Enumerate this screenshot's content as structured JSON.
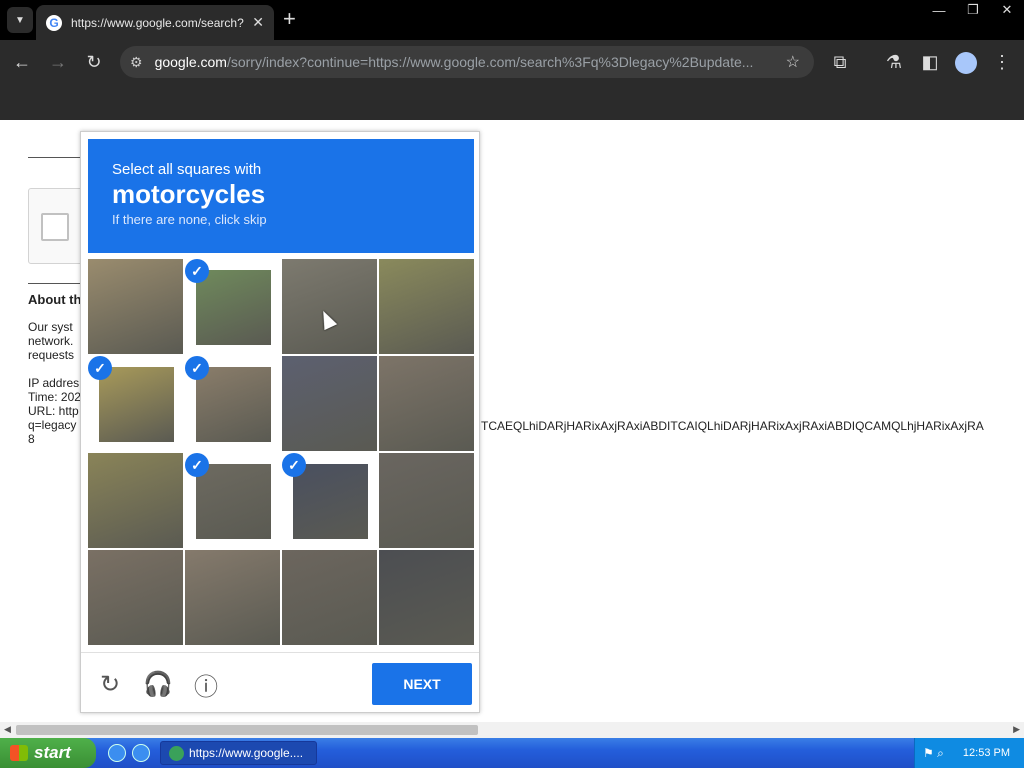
{
  "browser": {
    "tab_title": "https://www.google.com/search?q=",
    "tab_favicon": "G",
    "url_host": "google.com",
    "url_path": "/sorry/index?continue=https://www.google.com/search%3Fq%3Dlegacy%2Bupdate..."
  },
  "page": {
    "about_heading": "About th",
    "body_lines": [
      "Our syst",
      "network.",
      "requests"
    ],
    "info_lines": [
      "IP addres",
      "Time: 202",
      "URL: http",
      "q=legacy",
      "8"
    ],
    "long_line": "TCAEQLhiDARjHARixAxjRAxiABDITCAIQLhiDARjHARixAxjRAxiABDIQCAMQLhjHARixAxjRA"
  },
  "captcha": {
    "instruction": "Select all squares with",
    "target": "motorcycles",
    "hint": "If there are none, click skip",
    "next_label": "NEXT",
    "selected_tiles": [
      1,
      4,
      5,
      9,
      10
    ],
    "tile_colors": [
      "#9a8c6e",
      "#6f8a5c",
      "#7d7a6f",
      "#8a8a5c",
      "#a89a5a",
      "#8a7d6a",
      "#5c6070",
      "#7d7468",
      "#8a8458",
      "#6d6a60",
      "#4a5060",
      "#6a6660",
      "#7a7064",
      "#857a6c",
      "#6c665e",
      "#4c4e52"
    ]
  },
  "taskbar": {
    "start_label": "start",
    "task_label": "https://www.google....",
    "clock": "12:53 PM"
  }
}
